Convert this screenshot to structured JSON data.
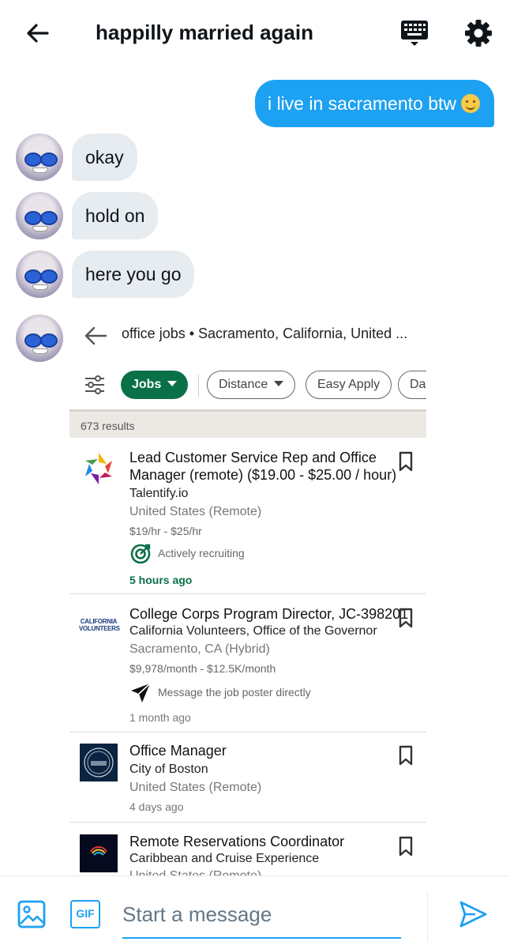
{
  "header": {
    "title": "happilly married again"
  },
  "messages": {
    "outgoing_text": "i live in sacramento btw",
    "incoming": [
      {
        "text": "okay"
      },
      {
        "text": "hold on"
      },
      {
        "text": "here you go"
      }
    ]
  },
  "shared_card": {
    "search_query": "office jobs • Sacramento, California, United ...",
    "filters": {
      "jobs": "Jobs",
      "distance": "Distance",
      "easy_apply": "Easy Apply",
      "date": "Da"
    },
    "results_count": "673 results",
    "jobs": [
      {
        "title": "Lead Customer Service Rep and Office Manager (remote) ($19.00 - $25.00 / hour)",
        "company": "Talentify.io",
        "location": "United States (Remote)",
        "salary": "$19/hr - $25/hr",
        "extra": "Actively recruiting",
        "posted": "5 hours ago"
      },
      {
        "title": "College Corps Program Director, JC-398201",
        "company": "California Volunteers, Office of the Governor",
        "location": "Sacramento, CA (Hybrid)",
        "salary": "$9,978/month - $12.5K/month",
        "extra": "Message the job poster directly",
        "posted": "1 month ago",
        "logo_text": "CALIFORNIA VOLUNTEERS"
      },
      {
        "title": "Office Manager",
        "company": "City of Boston",
        "location": "United States (Remote)",
        "posted": "4 days ago"
      },
      {
        "title": "Remote Reservations Coordinator",
        "company": "Caribbean and Cruise Experience",
        "location": "United States (Remote)"
      }
    ]
  },
  "composer": {
    "placeholder": "Start a message",
    "gif_label": "GIF"
  },
  "colors": {
    "accent": "#1da1f2",
    "linkedin_green": "#0a7048",
    "bubble_in": "#e6ecf0"
  }
}
